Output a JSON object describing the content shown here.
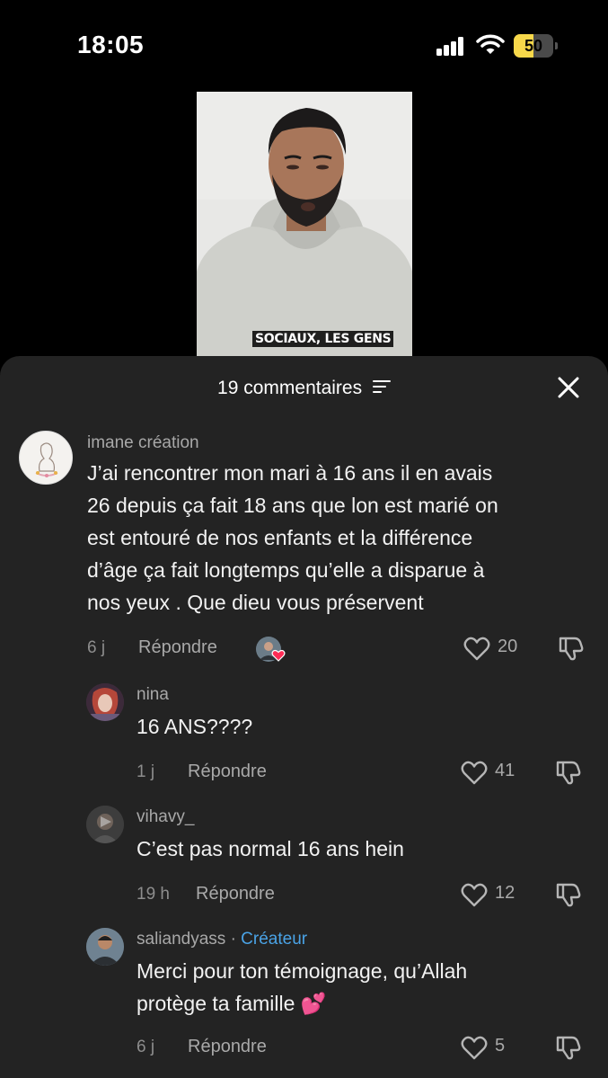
{
  "status_bar": {
    "time": "18:05",
    "battery_percent": "50",
    "battery_level": 0.5,
    "icons": [
      "signal-icon",
      "wifi-icon",
      "battery-icon"
    ]
  },
  "video": {
    "caption": "SOCIAUX, LES GENS"
  },
  "sheet": {
    "title": "19 commentaires",
    "filter_icon": "filter-icon",
    "close_icon": "close-icon"
  },
  "comments": [
    {
      "name": "imane création",
      "text_lines": [
        "J’ai rencontrer mon mari à 16 ans il en avais",
        "26 depuis ça fait 18 ans que lon est marié on",
        "est entouré de nos enfants et la différence",
        "d’âge ça fait longtemps qu’elle a disparue à",
        "nos yeux . Que dieu vous préservent"
      ],
      "time": "6 j",
      "reply": "Répondre",
      "likes": "20"
    },
    {
      "name": "nina",
      "text_lines": [
        "16 ANS????"
      ],
      "time": "1 j",
      "reply": "Répondre",
      "likes": "41"
    },
    {
      "name": "vihavy_",
      "text_lines": [
        "C’est pas normal 16 ans hein"
      ],
      "time": "19 h",
      "reply": "Répondre",
      "likes": "12"
    },
    {
      "name": "saliandyass",
      "separator": "·",
      "badge": "Créateur",
      "text_lines": [
        "Merci pour ton témoignage, qu’Allah",
        "protège ta famille 💕"
      ],
      "time": "6 j",
      "reply": "Répondre",
      "likes": "5"
    }
  ],
  "colors": {
    "sheet_bg": "#232323",
    "creator_badge": "#4aa3e6",
    "battery_fill": "#f7d84a"
  }
}
